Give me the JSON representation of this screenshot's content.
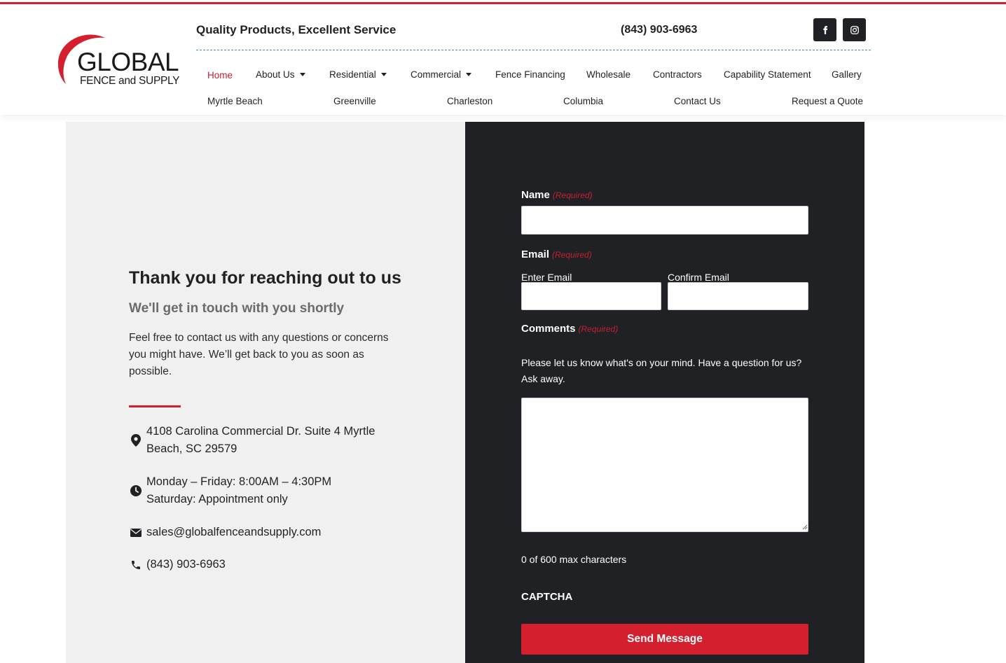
{
  "header": {
    "logo_word": "GLOBAL",
    "logo_sub": "FENCE and SUPPLY",
    "tagline": "Quality Products, Excellent Service",
    "phone": "(843) 903-6963",
    "social": [
      {
        "icon": "facebook-icon"
      },
      {
        "icon": "instagram-icon"
      }
    ],
    "accent_color": "#d41f2f"
  },
  "nav": {
    "row1": [
      {
        "label": "Home",
        "active": true
      },
      {
        "label": "About Us",
        "dropdown": true
      },
      {
        "label": "Residential",
        "dropdown": true
      },
      {
        "label": "Commercial",
        "dropdown": true
      },
      {
        "label": "Fence Financing"
      },
      {
        "label": "Wholesale"
      },
      {
        "label": "Contractors"
      },
      {
        "label": "Capability Statement"
      },
      {
        "label": "Gallery"
      }
    ],
    "row2": [
      {
        "label": "Myrtle Beach"
      },
      {
        "label": "Greenville"
      },
      {
        "label": "Charleston"
      },
      {
        "label": "Columbia"
      },
      {
        "label": "Contact Us"
      },
      {
        "label": "Request a Quote"
      }
    ]
  },
  "contact_info": {
    "title": "Thank you for reaching out to us",
    "subtitle": "We'll get in touch with you shortly",
    "body": "Feel free to contact us with any questions or concerns you might have. We’ll get back to you as soon as possible.",
    "address": "4108 Carolina Commercial Dr. Suite 4 Myrtle Beach, SC 29579",
    "hours_line1": "Monday – Friday: 8:00AM – 4:30PM",
    "hours_line2": "Saturday: Appointment only",
    "email": "sales@globalfenceandsupply.com",
    "phone": "(843) 903-6963"
  },
  "form": {
    "required_text": "(Required)",
    "name_label": "Name",
    "name_value": "",
    "email_label": "Email",
    "enter_email_label": "Enter Email",
    "confirm_email_label": "Confirm Email",
    "email_value": "",
    "confirm_email_value": "",
    "comments_label": "Comments",
    "comments_desc": "Please let us know what's on your mind. Have a question for us? Ask away.",
    "comments_value": "",
    "char_count": "0 of 600 max characters",
    "captcha_label": "CAPTCHA",
    "submit_label": "Send Message"
  }
}
